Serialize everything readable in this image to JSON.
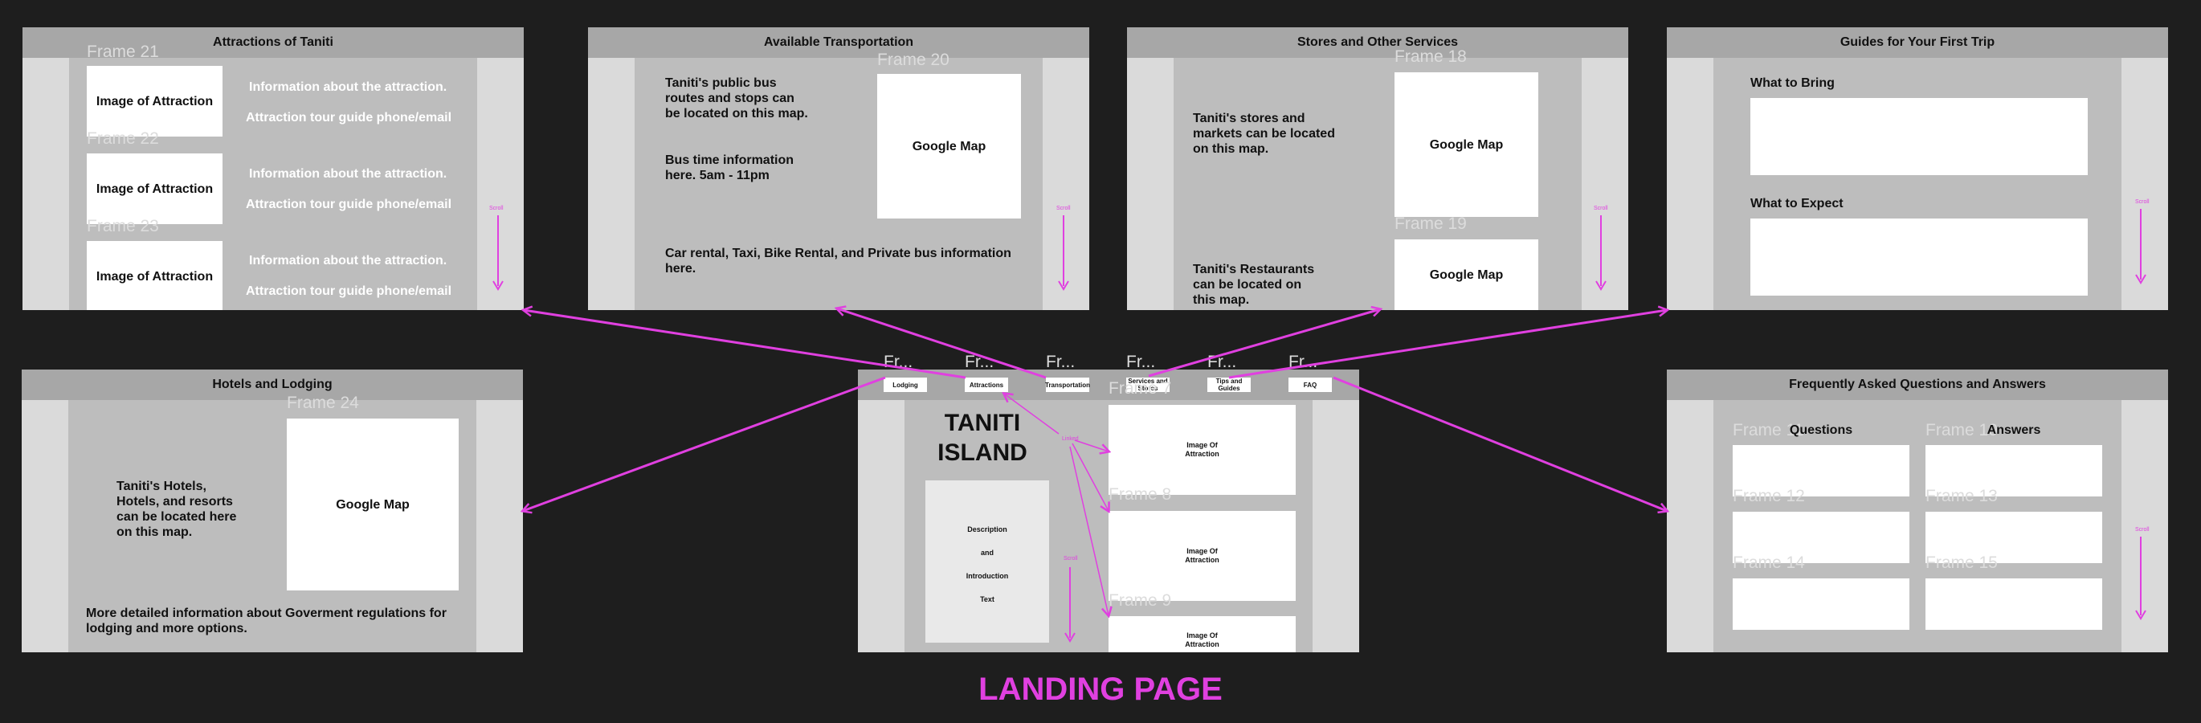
{
  "page_title": "LANDING PAGE",
  "colors": {
    "background": "#1e1e1e",
    "panel": "#bdbdbd",
    "header": "#a7a7a7",
    "gutter": "#dadada",
    "accent": "#e040e0"
  },
  "scroll_label": "Scroll",
  "attractions": {
    "title": "Attractions of Taniti",
    "items": [
      {
        "frame": "Frame 21",
        "image": "Image of Attraction",
        "info": "Information about the attraction.",
        "contact": "Attraction tour guide phone/email"
      },
      {
        "frame": "Frame 22",
        "image": "Image of Attraction",
        "info": "Information about the attraction.",
        "contact": "Attraction tour guide phone/email"
      },
      {
        "frame": "Frame 23",
        "image": "Image of Attraction",
        "info": "Information about the attraction.",
        "contact": "Attraction tour guide phone/email"
      }
    ]
  },
  "transportation": {
    "title": "Available Transportation",
    "frame": "Frame 20",
    "bus_text": "Taniti's public bus routes and stops can be located on this map.",
    "bus_time": "Bus time information here. 5am - 11pm",
    "map": "Google Map",
    "other_text": "Car rental, Taxi, Bike Rental, and Private bus information here."
  },
  "stores": {
    "title": "Stores and Other Services",
    "frame_a": "Frame 18",
    "frame_b": "Frame 19",
    "stores_text": "Taniti's stores and markets can be located on this map.",
    "restaurants_text": "Taniti's Restaurants can be located on this map.",
    "map_a": "Google Map",
    "map_b": "Google Map"
  },
  "guides": {
    "title": "Guides for Your First Trip",
    "bring": "What to Bring",
    "expect": "What to Expect"
  },
  "hotels": {
    "title": "Hotels and Lodging",
    "frame": "Frame 24",
    "text": "Taniti's Hotels, Hotels, and resorts can be located here on this map.",
    "map": "Google Map",
    "more": "More detailed information about Goverment regulations for lodging and more options."
  },
  "landing": {
    "nav_frame_labels": [
      "Fr...",
      "Fr...",
      "Fr...",
      "Fr...",
      "Fr...",
      "Fr..."
    ],
    "nav": [
      "Lodging",
      "Attractions",
      "Transportation",
      "Services and Stores",
      "Tips and Guides",
      "FAQ"
    ],
    "title_line1": "TANITI",
    "title_line2": "ISLAND",
    "desc": [
      "Description",
      "and",
      "Introduction",
      "Text"
    ],
    "link_label": "Linked",
    "frames": [
      "Frame 7",
      "Frame 8",
      "Frame 9"
    ],
    "images": [
      "Image Of Attraction",
      "Image Of Attraction",
      "Image Of Attraction"
    ]
  },
  "faq": {
    "title": "Frequently Asked Questions and Answers",
    "questions": "Questions",
    "answers": "Answers",
    "frames": [
      "Frame 11",
      "Frame 12",
      "Frame 14",
      "Frame 10",
      "Frame 13",
      "Frame 15"
    ]
  }
}
